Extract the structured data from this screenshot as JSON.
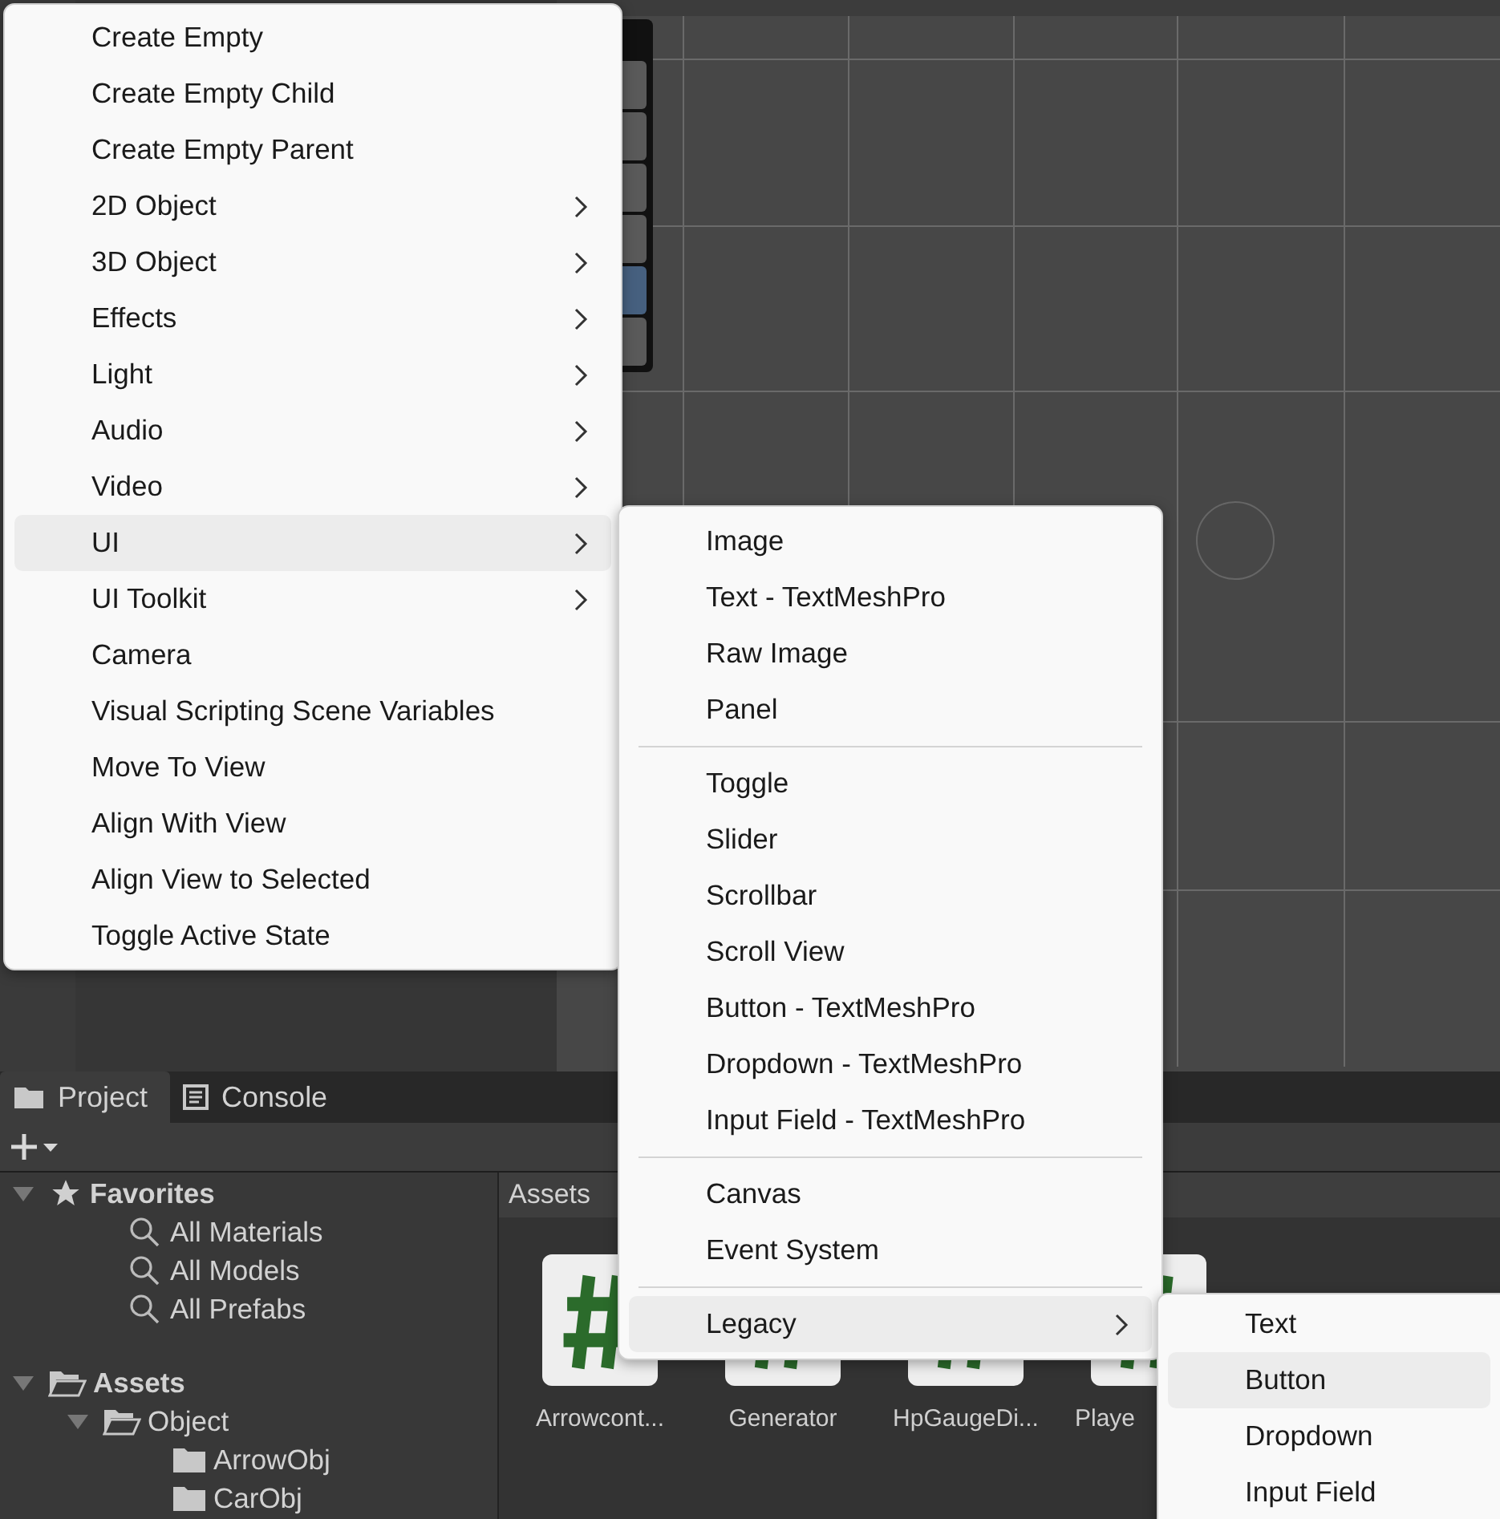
{
  "scene_tools": [
    {
      "selected": false
    },
    {
      "selected": false
    },
    {
      "selected": false
    },
    {
      "selected": false
    },
    {
      "selected": true
    },
    {
      "selected": false
    }
  ],
  "context_menu": {
    "items": [
      {
        "label": "Create Empty",
        "submenu": false,
        "selected": false
      },
      {
        "label": "Create Empty Child",
        "submenu": false,
        "selected": false
      },
      {
        "label": "Create Empty Parent",
        "submenu": false,
        "selected": false
      },
      {
        "label": "2D Object",
        "submenu": true,
        "selected": false
      },
      {
        "label": "3D Object",
        "submenu": true,
        "selected": false
      },
      {
        "label": "Effects",
        "submenu": true,
        "selected": false
      },
      {
        "label": "Light",
        "submenu": true,
        "selected": false
      },
      {
        "label": "Audio",
        "submenu": true,
        "selected": false
      },
      {
        "label": "Video",
        "submenu": true,
        "selected": false
      },
      {
        "label": "UI",
        "submenu": true,
        "selected": true
      },
      {
        "label": "UI Toolkit",
        "submenu": true,
        "selected": false
      },
      {
        "label": "Camera",
        "submenu": false,
        "selected": false
      },
      {
        "label": "Visual Scripting Scene Variables",
        "submenu": false,
        "selected": false
      },
      {
        "label": "Move To View",
        "submenu": false,
        "selected": false
      },
      {
        "label": "Align With View",
        "submenu": false,
        "selected": false
      },
      {
        "label": "Align View to Selected",
        "submenu": false,
        "selected": false
      },
      {
        "label": "Toggle Active State",
        "submenu": false,
        "selected": false
      }
    ]
  },
  "ui_submenu": {
    "items": [
      {
        "kind": "item",
        "label": "Image",
        "submenu": false,
        "selected": false
      },
      {
        "kind": "item",
        "label": "Text - TextMeshPro",
        "submenu": false,
        "selected": false
      },
      {
        "kind": "item",
        "label": "Raw Image",
        "submenu": false,
        "selected": false
      },
      {
        "kind": "item",
        "label": "Panel",
        "submenu": false,
        "selected": false
      },
      {
        "kind": "separator"
      },
      {
        "kind": "item",
        "label": "Toggle",
        "submenu": false,
        "selected": false
      },
      {
        "kind": "item",
        "label": "Slider",
        "submenu": false,
        "selected": false
      },
      {
        "kind": "item",
        "label": "Scrollbar",
        "submenu": false,
        "selected": false
      },
      {
        "kind": "item",
        "label": "Scroll View",
        "submenu": false,
        "selected": false
      },
      {
        "kind": "item",
        "label": "Button - TextMeshPro",
        "submenu": false,
        "selected": false
      },
      {
        "kind": "item",
        "label": "Dropdown - TextMeshPro",
        "submenu": false,
        "selected": false
      },
      {
        "kind": "item",
        "label": "Input Field - TextMeshPro",
        "submenu": false,
        "selected": false
      },
      {
        "kind": "separator"
      },
      {
        "kind": "item",
        "label": "Canvas",
        "submenu": false,
        "selected": false
      },
      {
        "kind": "item",
        "label": "Event System",
        "submenu": false,
        "selected": false
      },
      {
        "kind": "separator"
      },
      {
        "kind": "item",
        "label": "Legacy",
        "submenu": true,
        "selected": true
      }
    ]
  },
  "legacy_submenu": {
    "items": [
      {
        "label": "Text",
        "selected": false
      },
      {
        "label": "Button",
        "selected": true
      },
      {
        "label": "Dropdown",
        "selected": false
      },
      {
        "label": "Input Field",
        "selected": false
      }
    ]
  },
  "panel_tabs": [
    {
      "label": "Project",
      "kind": "folder",
      "selected": true
    },
    {
      "label": "Console",
      "kind": "console",
      "selected": false
    }
  ],
  "project_tree": [
    {
      "label": "Favorites",
      "kind": "favorites",
      "expanded": true,
      "children": [
        {
          "label": "All Materials",
          "kind": "search"
        },
        {
          "label": "All Models",
          "kind": "search"
        },
        {
          "label": "All Prefabs",
          "kind": "search"
        }
      ]
    },
    {
      "label": "Assets",
      "kind": "root",
      "expanded": true,
      "children": [
        {
          "label": "Object",
          "kind": "folder",
          "expanded": true,
          "children": [
            {
              "label": "ArrowObj",
              "kind": "folder"
            },
            {
              "label": "CarObj",
              "kind": "folder"
            }
          ]
        }
      ]
    }
  ],
  "assets_header": "Assets",
  "assets": [
    {
      "name": "Arrowcont..."
    },
    {
      "name": "Generator"
    },
    {
      "name": "HpGaugeDi..."
    },
    {
      "name": "Playe"
    }
  ]
}
